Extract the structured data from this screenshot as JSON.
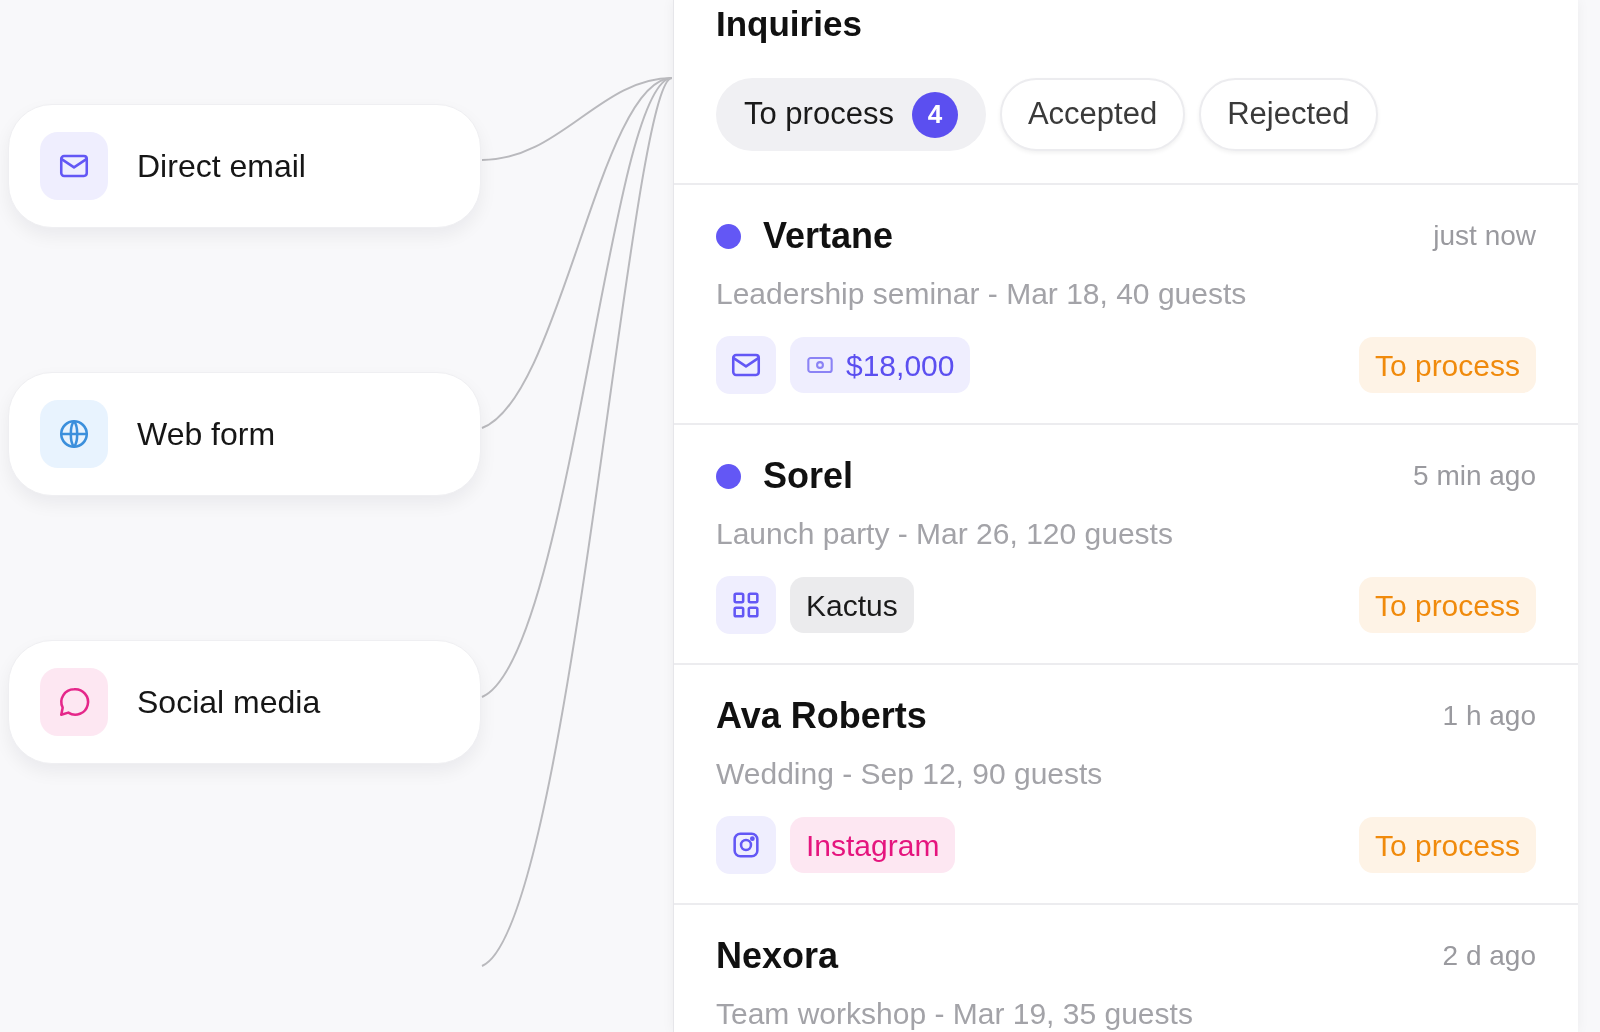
{
  "sources": [
    {
      "label": "Direct email",
      "kind": "mail"
    },
    {
      "label": "Web form",
      "kind": "globe"
    },
    {
      "label": "Social media",
      "kind": "chat"
    }
  ],
  "panel": {
    "title": "Inquiries",
    "tabs": [
      {
        "label": "To process",
        "count": "4",
        "selected": true
      },
      {
        "label": "Accepted",
        "selected": false
      },
      {
        "label": "Rejected",
        "selected": false
      }
    ],
    "inquiries": [
      {
        "name": "Vertane",
        "unread": true,
        "time": "just now",
        "details": "Leadership seminar - Mar 18, 40 guests",
        "channel": {
          "kind": "mail"
        },
        "tag": {
          "kind": "amount",
          "label": "$18,000"
        },
        "status": "To process"
      },
      {
        "name": "Sorel",
        "unread": true,
        "time": "5 min ago",
        "details": "Launch party - Mar 26, 120 guests",
        "channel": {
          "kind": "grid"
        },
        "tag": {
          "kind": "company",
          "label": "Kactus"
        },
        "status": "To process"
      },
      {
        "name": "Ava Roberts",
        "unread": false,
        "time": "1 h ago",
        "details": "Wedding - Sep 12, 90 guests",
        "channel": {
          "kind": "instagram"
        },
        "tag": {
          "kind": "social",
          "label": "Instagram"
        },
        "status": "To process"
      },
      {
        "name": "Nexora",
        "unread": false,
        "time": "2 d ago",
        "details": "Team workshop - Mar 19, 35 guests"
      }
    ]
  }
}
